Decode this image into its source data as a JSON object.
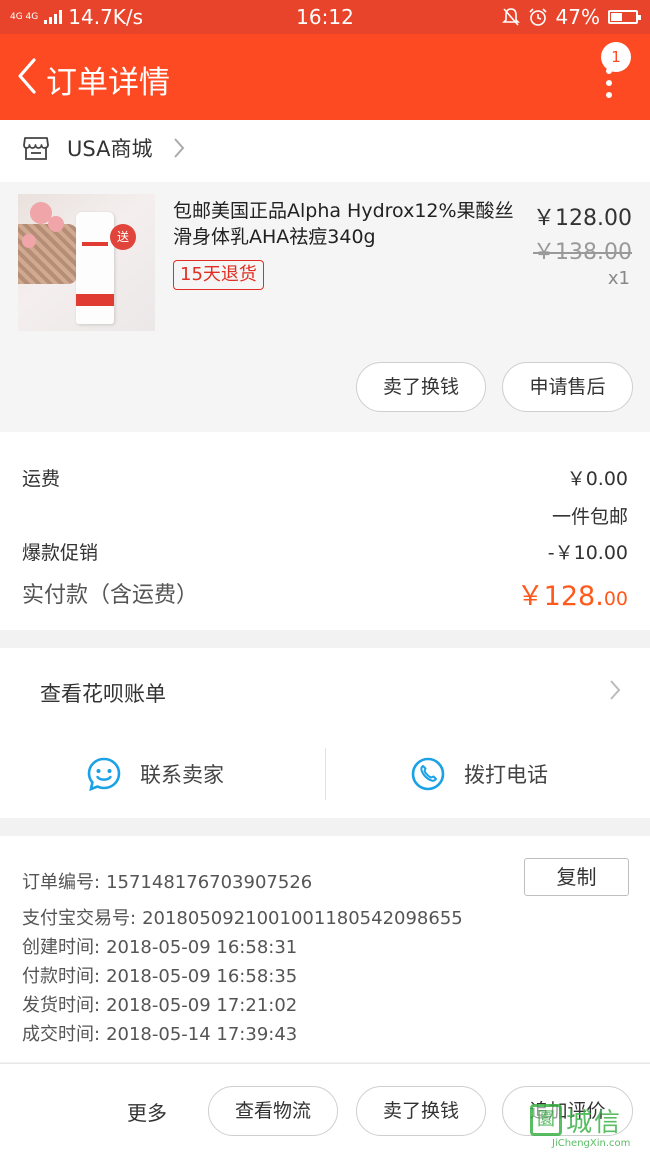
{
  "status_bar": {
    "network": "4G 4G",
    "speed": "14.7K/s",
    "time": "16:12",
    "battery": "47%",
    "battery_level": 0.47,
    "icons": [
      "bell-muted-icon",
      "alarm-icon"
    ]
  },
  "header": {
    "title": "订单详情",
    "badge_count": "1"
  },
  "store": {
    "name": "USA商城"
  },
  "product": {
    "title": "包邮美国正品Alpha Hydrox12%果酸丝滑身体乳AHA祛痘340g",
    "tag": "15天退货",
    "price": "￥128.00",
    "original_price": "￥138.00",
    "quantity": "x1",
    "image_badge": "送",
    "actions": [
      "卖了换钱",
      "申请售后"
    ]
  },
  "fees": {
    "shipping_label": "运费",
    "shipping_value": "￥0.00",
    "shipping_note": "一件包邮",
    "promo_label": "爆款促销",
    "promo_value": "-￥10.00",
    "paid_label": "实付款（含运费）",
    "paid_value_main": "￥128.",
    "paid_value_cents": "00",
    "accent_color": "#fe5a1c"
  },
  "huabei": {
    "label": "查看花呗账单"
  },
  "contact": {
    "seller_label": "联系卖家",
    "call_label": "拨打电话",
    "icon_color": "#1aa1e6"
  },
  "order_info": {
    "order_no_label": "订单编号:",
    "order_no": "157148176703907526",
    "copy_label": "复制",
    "alipay_label": "支付宝交易号:",
    "alipay_no": "2018050921001001180542098655",
    "created_label": "创建时间:",
    "created": "2018-05-09 16:58:31",
    "paid_label": "付款时间:",
    "paid": "2018-05-09 16:58:35",
    "shipped_label": "发货时间:",
    "shipped": "2018-05-09 17:21:02",
    "completed_label": "成交时间:",
    "completed": "2018-05-14 17:39:43"
  },
  "bottom_bar": {
    "more_label": "更多",
    "buttons": [
      "查看物流",
      "卖了换钱",
      "追加评价"
    ]
  },
  "watermark": {
    "logo_char": "圜",
    "name": "城信",
    "url": "JiChengXin.com"
  },
  "colors": {
    "brand": "#fe4a22",
    "status_bar": "#e8442c"
  }
}
